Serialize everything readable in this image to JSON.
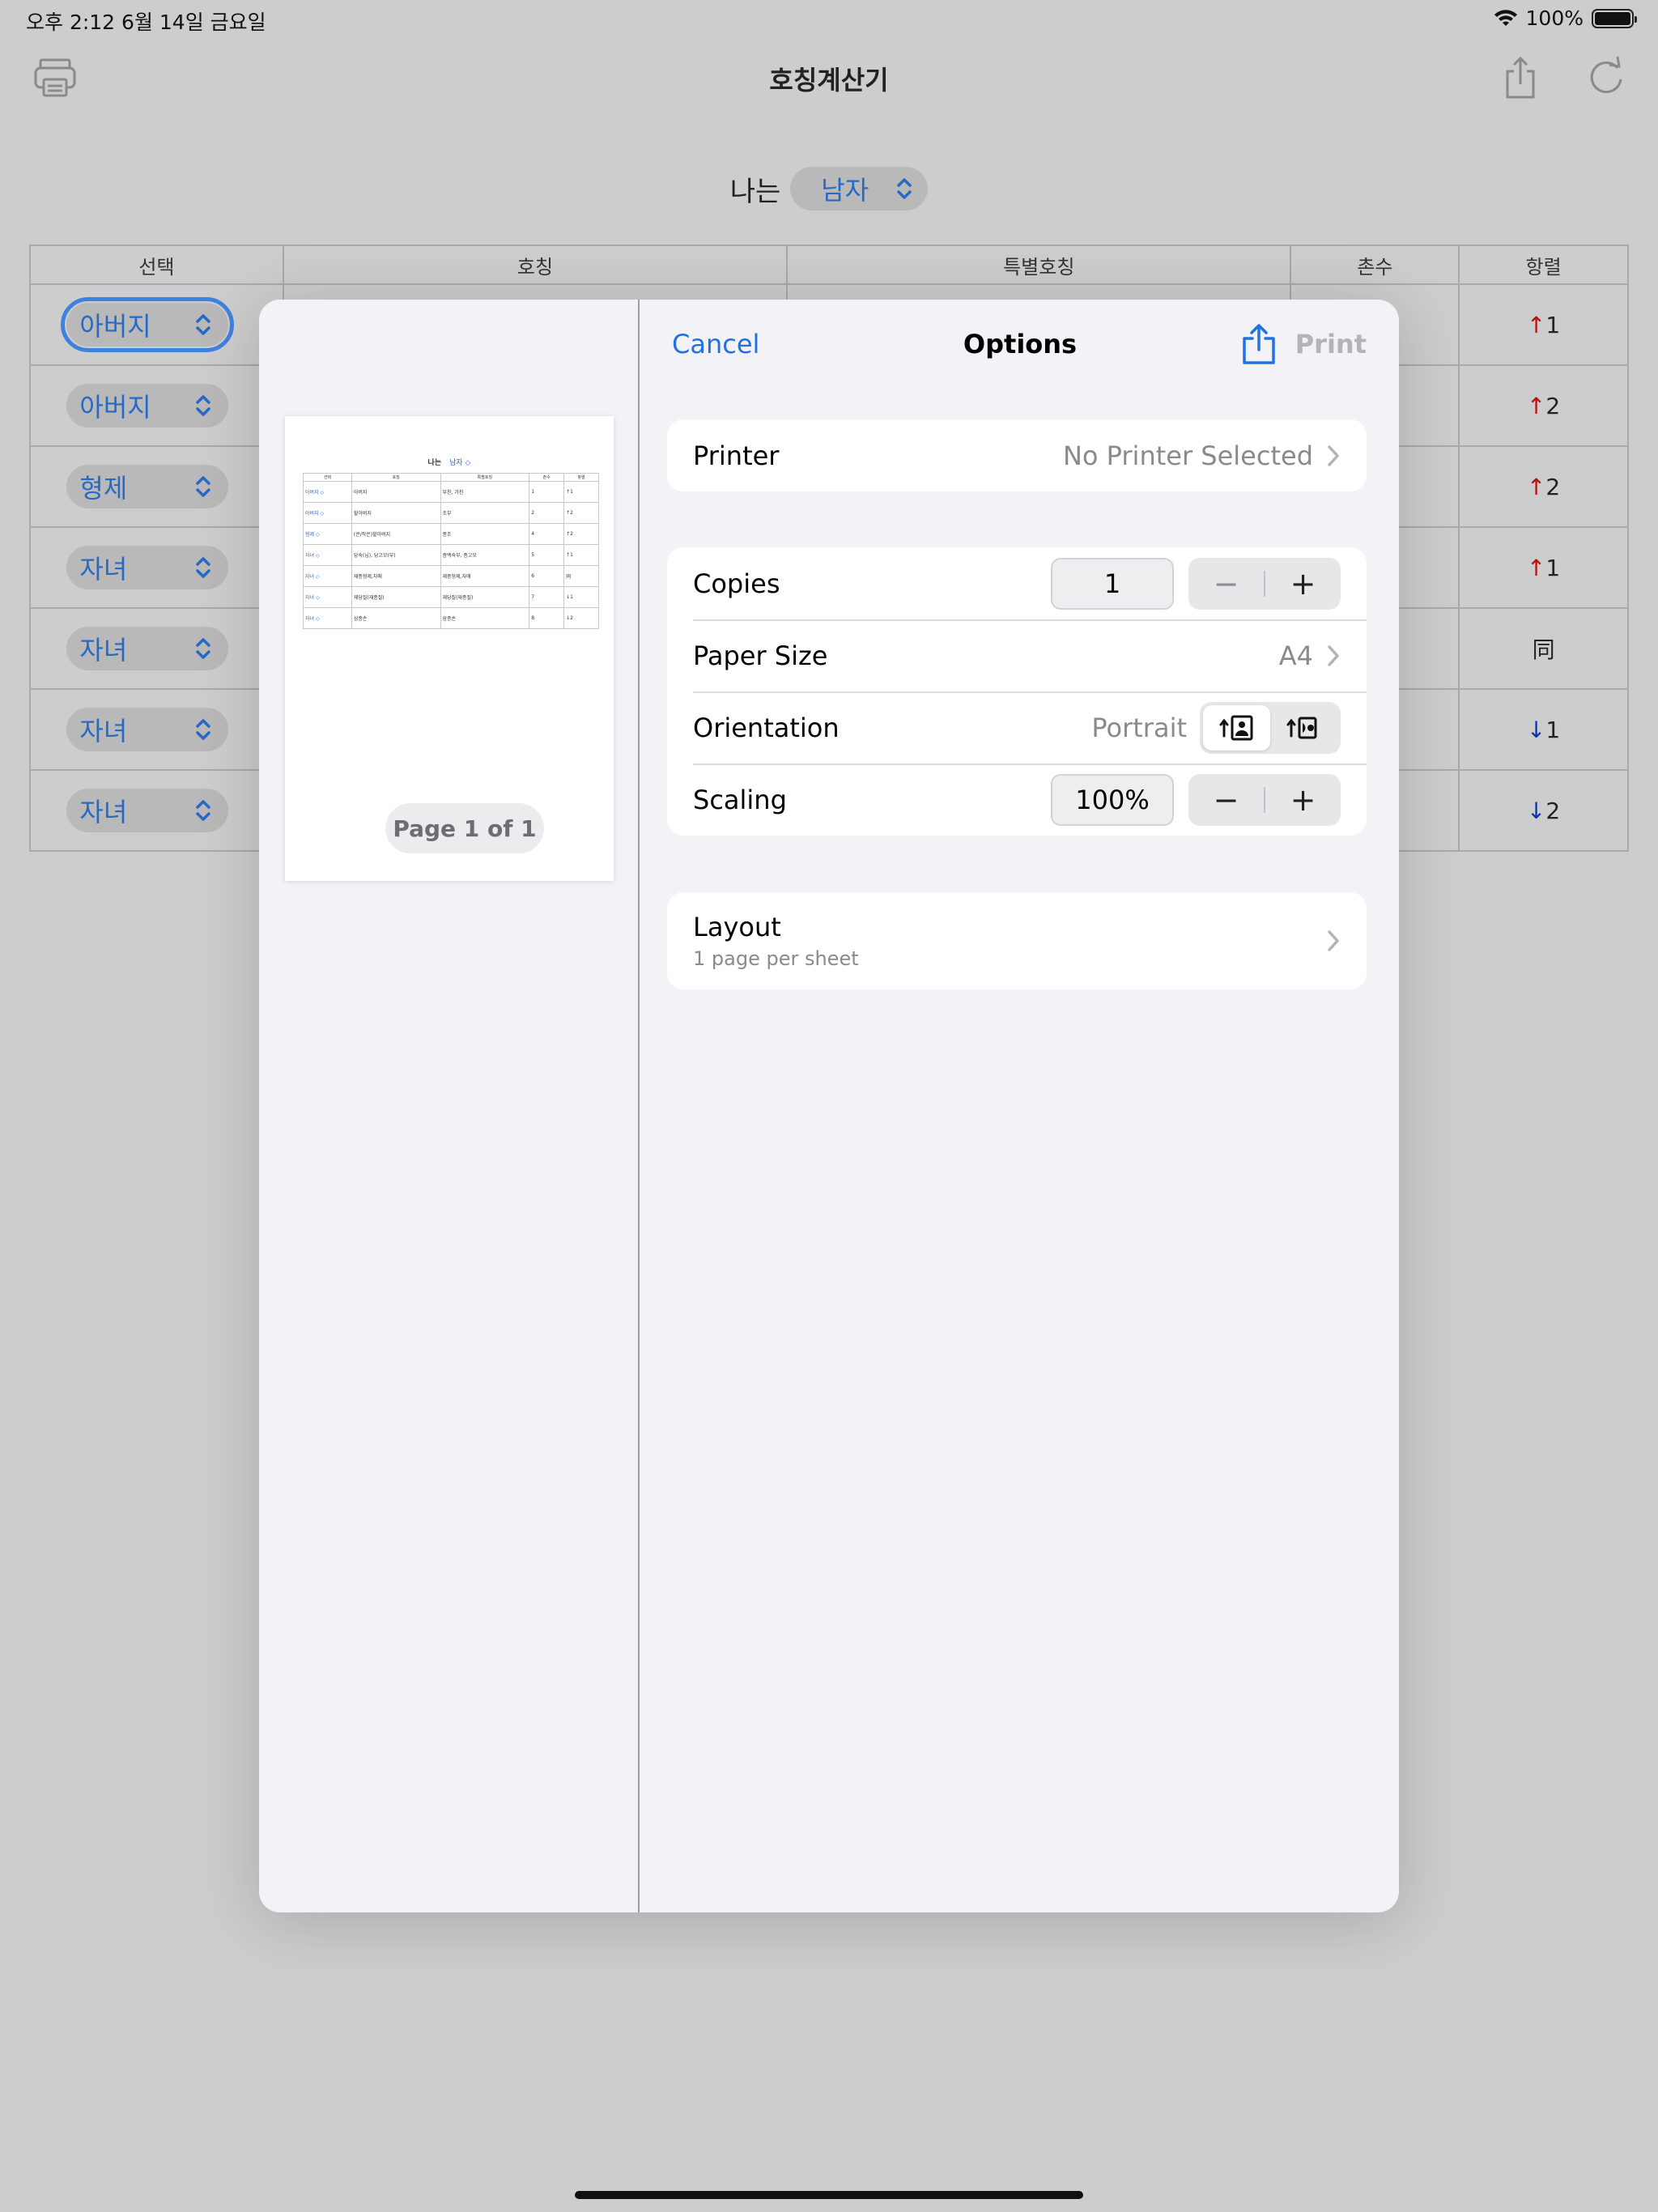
{
  "status_bar": {
    "time_date": "오후 2:12   6월 14일 금요일",
    "battery": "100%"
  },
  "app": {
    "title": "호칭계산기",
    "me_label": "나는",
    "gender": "남자",
    "table": {
      "headers": [
        "선택",
        "호칭",
        "특별호칭",
        "촌수",
        "항렬"
      ],
      "rows": [
        {
          "select": "아버지",
          "arrow": "↑",
          "gen": "1"
        },
        {
          "select": "아버지",
          "arrow": "↑",
          "gen": "2"
        },
        {
          "select": "형제",
          "arrow": "↑",
          "gen": "2"
        },
        {
          "select": "자녀",
          "arrow": "↑",
          "gen": "1"
        },
        {
          "select": "자녀",
          "arrow": "",
          "gen": "同"
        },
        {
          "select": "자녀",
          "arrow": "↓",
          "gen": "1"
        },
        {
          "select": "자녀",
          "arrow": "↓",
          "gen": "2"
        }
      ]
    }
  },
  "print": {
    "cancel": "Cancel",
    "title": "Options",
    "print": "Print",
    "page_indicator": "Page 1 of 1",
    "printer_label": "Printer",
    "printer_value": "No Printer Selected",
    "copies_label": "Copies",
    "copies_value": "1",
    "paper_label": "Paper Size",
    "paper_value": "A4",
    "orientation_label": "Orientation",
    "orientation_value": "Portrait",
    "scaling_label": "Scaling",
    "scaling_value": "100%",
    "layout_label": "Layout",
    "layout_value": "1 page per sheet",
    "minus": "−",
    "plus": "+"
  },
  "preview": {
    "head_label": "나는",
    "head_value": "남자 ◇",
    "headers": [
      "선택",
      "호칭",
      "특별호칭",
      "촌수",
      "항렬"
    ],
    "rows": [
      [
        "아버지 ◇",
        "아버지",
        "부친, 가친",
        "1",
        "↑1"
      ],
      [
        "아버지 ◇",
        "할아버지",
        "조부",
        "2",
        "↑2"
      ],
      [
        "형제 ◇",
        "(큰/작은)할아버지",
        "종조",
        "4",
        "↑2"
      ],
      [
        "자녀 ◇",
        "당숙(님), 당고모(부)",
        "종백숙부, 종고모",
        "5",
        "↑1"
      ],
      [
        "자녀 ◇",
        "재종형제,자매",
        "재종형제,자매",
        "6",
        "同"
      ],
      [
        "자녀 ◇",
        "재당질(재종질)",
        "재당질(재종질)",
        "7",
        "↓1"
      ],
      [
        "자녀 ◇",
        "삼종손",
        "삼종손",
        "8",
        "↓2"
      ]
    ]
  },
  "icons": {
    "print_icon": "printer-icon",
    "share_icon": "share-icon",
    "refresh_icon": "refresh-icon",
    "wifi_icon": "wifi-icon"
  },
  "colors": {
    "accent": "#1f72e0",
    "up_arrow": "#b81212",
    "down_arrow": "#1233a8"
  }
}
